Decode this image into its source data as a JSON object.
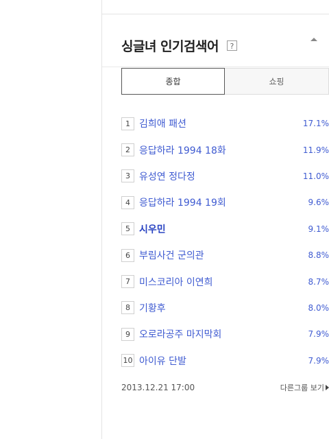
{
  "panel": {
    "title": "싱글녀 인기검색어",
    "help_symbol": "?",
    "tabs": [
      {
        "label": "종합",
        "active": true
      },
      {
        "label": "쇼핑",
        "active": false
      }
    ],
    "items": [
      {
        "rank": "1",
        "keyword": "김희애 패션",
        "percent": "17.1%",
        "bold": false
      },
      {
        "rank": "2",
        "keyword": "응답하라 1994 18화",
        "percent": "11.9%",
        "bold": false
      },
      {
        "rank": "3",
        "keyword": "유성연 정다정",
        "percent": "11.0%",
        "bold": false
      },
      {
        "rank": "4",
        "keyword": "응답하라 1994 19회",
        "percent": "9.6%",
        "bold": false
      },
      {
        "rank": "5",
        "keyword": "시우민",
        "percent": "9.1%",
        "bold": true
      },
      {
        "rank": "6",
        "keyword": "부림사건 군의관",
        "percent": "8.8%",
        "bold": false
      },
      {
        "rank": "7",
        "keyword": "미스코리아 이연희",
        "percent": "8.7%",
        "bold": false
      },
      {
        "rank": "8",
        "keyword": "기황후",
        "percent": "8.0%",
        "bold": false
      },
      {
        "rank": "9",
        "keyword": "오로라공주 마지막회",
        "percent": "7.9%",
        "bold": false
      },
      {
        "rank": "10",
        "keyword": "아이유 단발",
        "percent": "7.9%",
        "bold": false
      }
    ],
    "footer": {
      "timestamp": "2013.12.21 17:00",
      "more_label": "다른그룹 보기"
    }
  },
  "colors": {
    "keyword": "#3f5bd1",
    "title": "#222222",
    "border": "#e3e3e3"
  },
  "icons": {
    "help": "question-mark-box",
    "collapse": "caret-up",
    "more": "caret-right"
  }
}
